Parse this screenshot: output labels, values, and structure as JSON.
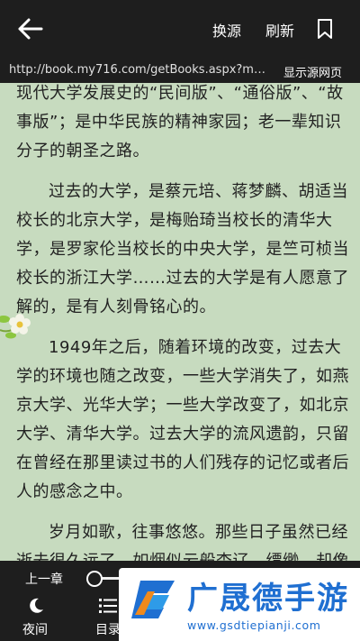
{
  "topbar": {
    "back_icon": "arrow-left-icon",
    "switch_source": "换源",
    "refresh": "刷新",
    "bookmark_icon": "bookmark-icon"
  },
  "urlbar": {
    "url": "http://book.my716.com/getBooks.aspx?m…",
    "show_source": "显示源网页"
  },
  "reader": {
    "paragraphs": [
      "现代大学发展史的“民间版”、“通俗版”、“故事版”；是中华民族的精神家园；老一辈知识分子的朝圣之路。",
      "过去的大学，是蔡元培、蒋梦麟、胡适当校长的北京大学，是梅贻琦当校长的清华大学，是罗家伦当校长的中央大学，是竺可桢当校长的浙江大学……过去的大学是有人愿意了解的，是有人刻骨铭心的。",
      "1949年之后，随着环境的改变，过去大学的环境也随之改变，一些大学消失了，如燕京大学、光华大学；一些大学改变了，如北京大学、清华大学。过去大学的流风遗韵，只留在曾经在那里读过书的人们残存的记忆或者后人的感念之中。",
      "岁月如歌，往事悠悠。那些日子虽然已经逝去很久远了，如烟似云般杳辽、缥缈，却像一座丰碑高高伫立着，辉映古今，光芒耀眼，是我们永远不应该忘记的。"
    ]
  },
  "bottombar": {
    "prev_chapter": "上一章",
    "night_label": "夜间",
    "night_icon": "moon-icon",
    "catalog_label": "目录",
    "catalog_icon": "list-icon"
  },
  "watermark": {
    "title": "广晟德手游",
    "url": "www.gsdtiepianji.com"
  },
  "colors": {
    "reader_background": "#c7dbbf",
    "bars": "#1e1e1e",
    "watermark_blue": "#1f6fd1"
  }
}
